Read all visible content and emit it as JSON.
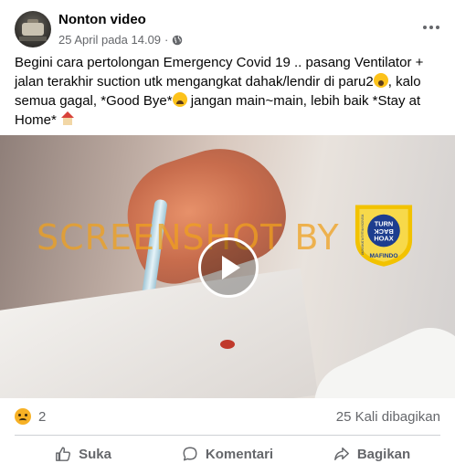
{
  "post": {
    "page_name": "Nonton video",
    "timestamp": "25 April pada 14.09",
    "separator": "·",
    "caption_parts": {
      "p1": "Begini cara pertolongan Emergency Covid 19 .. pasang Ventilator + jalan terakhir suction utk mengangkat dahak/lendir di paru2",
      "p2": ", kalo semua gagal, *Good Bye*",
      "p3": " jangan main~main, lebih baik *Stay at Home* "
    },
    "caption_icons": [
      "scream-emoji-icon",
      "crying-emoji-icon",
      "house-emoji-icon"
    ]
  },
  "video": {
    "watermark": "SCREENSHOT BY",
    "badge": {
      "ring_text": "MASYARAKAT ANTI FITNAH INDONESIA",
      "center_line1": "TURN",
      "center_line2": "BACK",
      "center_line3": "HOAX",
      "bottom_text": "MAFINDO"
    },
    "play_icon": "play-icon"
  },
  "stats": {
    "reaction_icon": "sad-reaction-icon",
    "reaction_count": "2",
    "shares": "25 Kali dibagikan"
  },
  "actions": {
    "like": "Suka",
    "comment": "Komentari",
    "share": "Bagikan"
  },
  "colors": {
    "secondary_text": "#65676b",
    "watermark": "#efa01e",
    "badge_ring": "#f2c200",
    "badge_center": "#1d3d8f"
  }
}
